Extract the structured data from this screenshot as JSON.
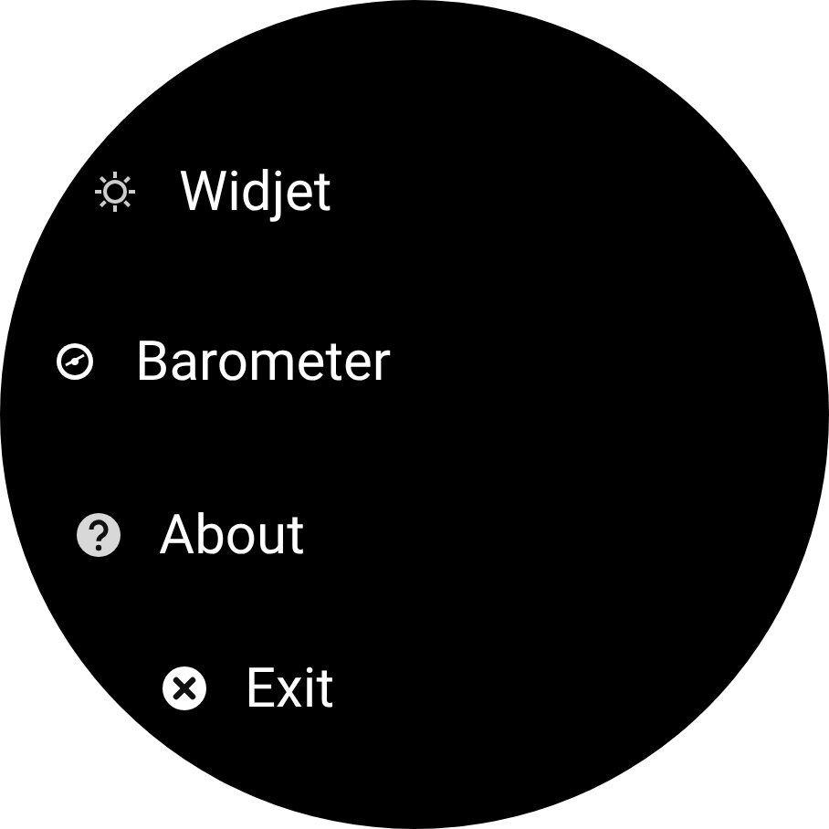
{
  "menu": {
    "items": [
      {
        "kind": "sun",
        "label": "Widjet"
      },
      {
        "kind": "gauge",
        "label": "Barometer"
      },
      {
        "kind": "help",
        "label": "About"
      },
      {
        "kind": "close",
        "label": "Exit"
      }
    ]
  }
}
